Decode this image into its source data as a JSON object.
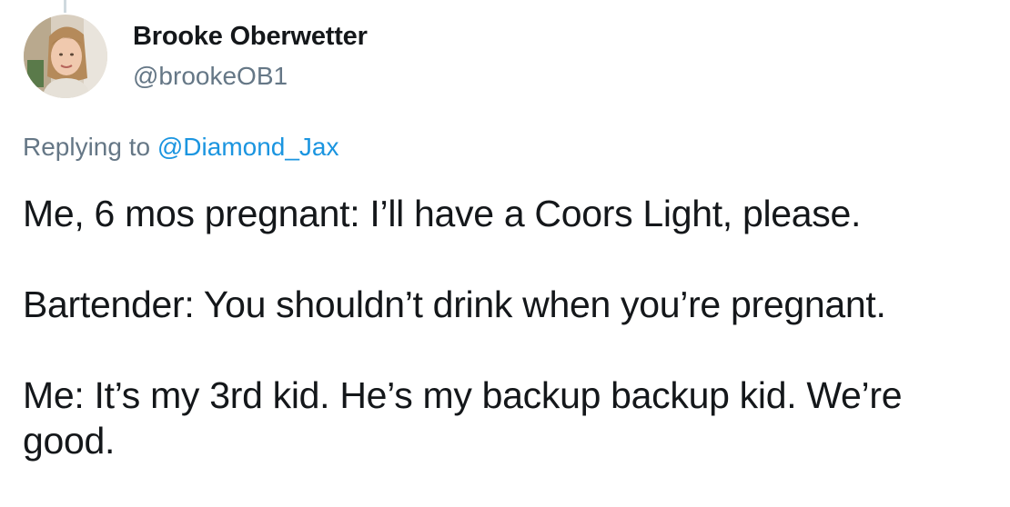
{
  "author": {
    "display_name": "Brooke Oberwetter",
    "handle": "@brookeOB1"
  },
  "reply": {
    "prefix": "Replying to ",
    "mention": "@Diamond_Jax"
  },
  "tweet": {
    "paragraphs": [
      "Me, 6 mos pregnant: I’ll have a Coors Light, please.",
      "Bartender: You shouldn’t drink when you’re pregnant.",
      "Me: It’s my 3rd kid. He’s my backup backup kid. We’re good."
    ]
  },
  "colors": {
    "text": "#14171a",
    "secondary": "#657786",
    "link": "#1b95e0"
  }
}
